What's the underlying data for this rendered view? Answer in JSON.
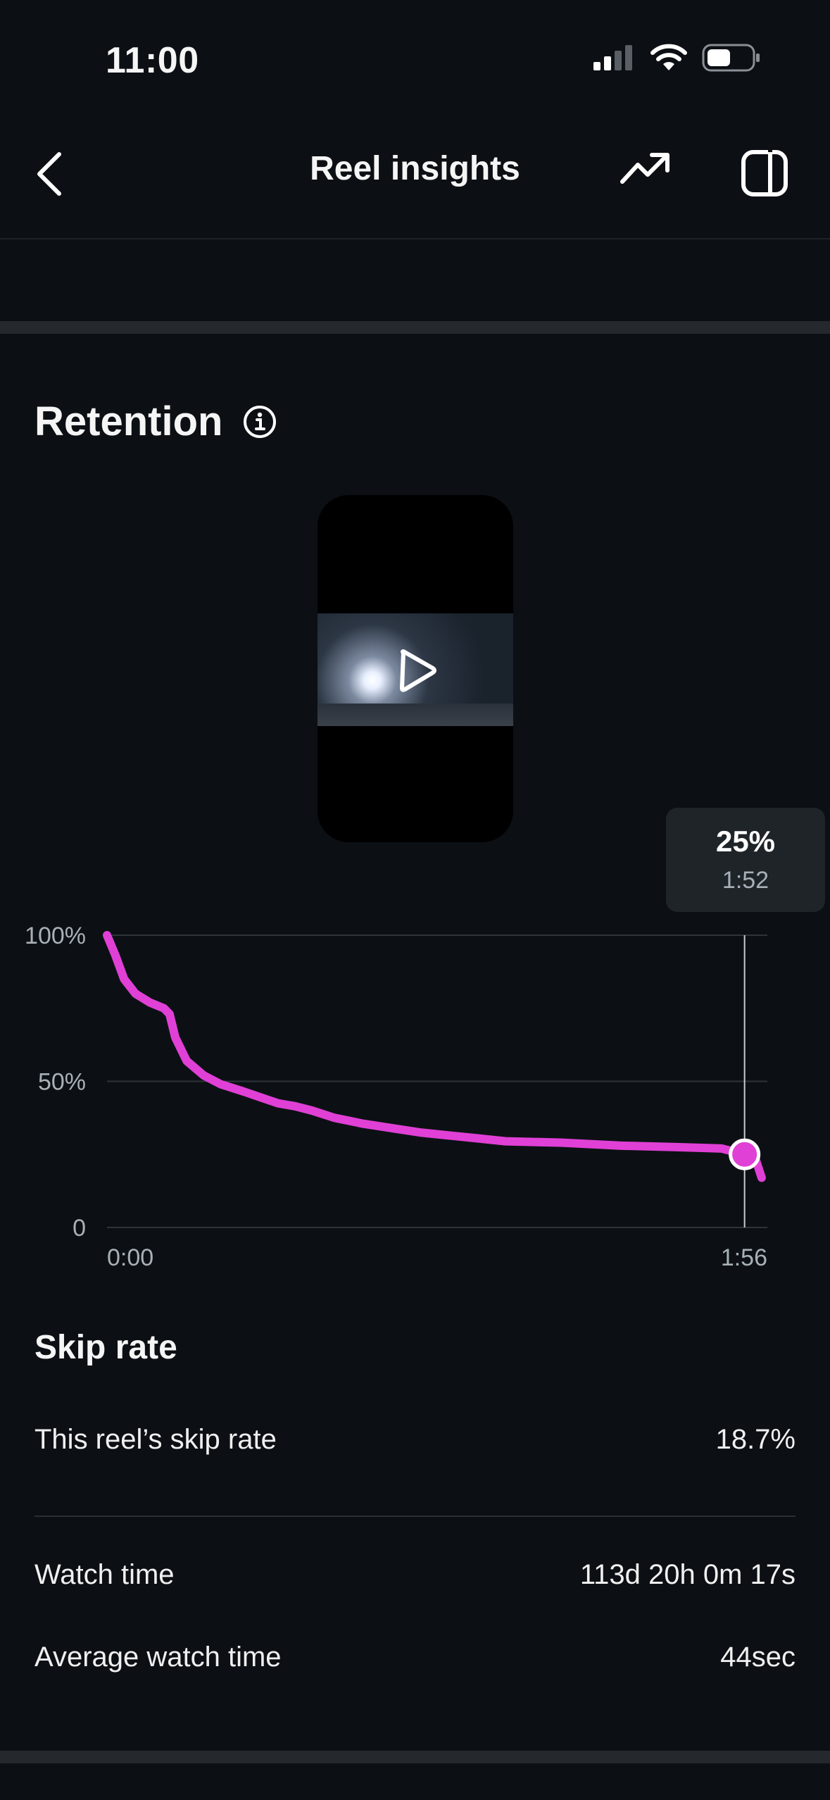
{
  "status_bar": {
    "time": "11:00"
  },
  "header": {
    "title": "Reel insights"
  },
  "retention": {
    "title": "Retention",
    "tooltip": {
      "value": "25%",
      "time": "1:52"
    }
  },
  "colors": {
    "accent": "#e040d6",
    "background": "#0c1014",
    "tooltip_bg": "#1f2429"
  },
  "chart_data": {
    "type": "line",
    "title": "",
    "xlabel": "",
    "ylabel": "",
    "y_tick_labels": [
      "100%",
      "50%",
      "0"
    ],
    "x_tick_labels": [
      "0:00",
      "1:56"
    ],
    "ylim": [
      0,
      100
    ],
    "xlim": [
      0,
      116
    ],
    "x_unit": "seconds",
    "grid": true,
    "series": [
      {
        "color": "#e040d6",
        "x": [
          0,
          1.5,
          3,
          5,
          7.5,
          10,
          11,
          12,
          14,
          17,
          20,
          24,
          27,
          30,
          33,
          36,
          40,
          45,
          50,
          55,
          60,
          65,
          70,
          80,
          90,
          100,
          108,
          112,
          114,
          115
        ],
        "y": [
          100,
          93,
          85,
          80,
          77,
          75,
          73,
          65,
          57,
          52,
          49,
          46.5,
          44.5,
          42.5,
          41.5,
          40,
          37.5,
          35.5,
          34,
          32.5,
          31.5,
          30.5,
          29.5,
          29,
          28,
          27.5,
          27,
          25,
          23,
          17
        ]
      }
    ],
    "highlight": {
      "x": 112,
      "y": 25,
      "label_value": "25%",
      "label_time": "1:52"
    }
  },
  "skip_rate": {
    "title": "Skip rate",
    "rows": [
      {
        "label": "This reel’s skip rate",
        "value": "18.7%"
      }
    ]
  },
  "watch": {
    "rows": [
      {
        "label": "Watch time",
        "value": "113d 20h 0m 17s"
      },
      {
        "label": "Average watch time",
        "value": "44sec"
      }
    ]
  }
}
